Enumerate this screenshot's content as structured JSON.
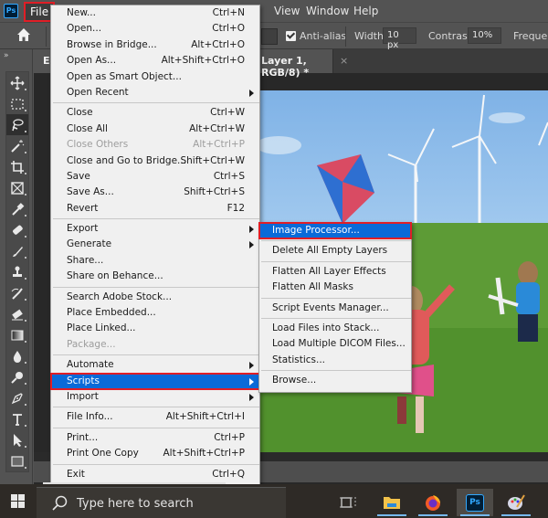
{
  "app": {
    "name": "Photoshop",
    "logo_text": "Ps"
  },
  "menubar": {
    "items": [
      {
        "label": "File",
        "active": true
      },
      {
        "label": "View"
      },
      {
        "label": "Window"
      },
      {
        "label": "Help"
      }
    ]
  },
  "options_bar": {
    "anti_alias_label": "Anti-alias",
    "anti_alias_checked": true,
    "width_label": "Width:",
    "width_value": "10 px",
    "contrast_label": "Contrast:",
    "contrast_value": "10%",
    "frequency_label": "Frequenc"
  },
  "document_tab": {
    "title_start": "E(",
    "title_end": "Layer 1, RGB/8) *",
    "close_glyph": "×"
  },
  "toolbar": {
    "collapse_glyph": "»",
    "tools": [
      "move-tool",
      "marquee-tool",
      "magnetic-lasso-tool",
      "magic-wand-tool",
      "crop-tool",
      "frame-tool",
      "eyedropper-tool",
      "healing-brush-tool",
      "brush-tool",
      "clone-stamp-tool",
      "history-brush-tool",
      "eraser-tool",
      "gradient-tool",
      "blur-tool",
      "dodge-tool",
      "pen-tool",
      "type-tool",
      "path-selection-tool",
      "rectangle-tool"
    ],
    "active_tool": "magnetic-lasso-tool"
  },
  "file_menu": {
    "groups": [
      [
        {
          "label": "New...",
          "shortcut": "Ctrl+N"
        },
        {
          "label": "Open...",
          "shortcut": "Ctrl+O"
        },
        {
          "label": "Browse in Bridge...",
          "shortcut": "Alt+Ctrl+O"
        },
        {
          "label": "Open As...",
          "shortcut": "Alt+Shift+Ctrl+O"
        },
        {
          "label": "Open as Smart Object...",
          "shortcut": ""
        },
        {
          "label": "Open Recent",
          "shortcut": "",
          "submenu": true
        }
      ],
      [
        {
          "label": "Close",
          "shortcut": "Ctrl+W"
        },
        {
          "label": "Close All",
          "shortcut": "Alt+Ctrl+W"
        },
        {
          "label": "Close Others",
          "shortcut": "Alt+Ctrl+P",
          "disabled": true
        },
        {
          "label": "Close and Go to Bridge...",
          "shortcut": "Shift+Ctrl+W"
        },
        {
          "label": "Save",
          "shortcut": "Ctrl+S"
        },
        {
          "label": "Save As...",
          "shortcut": "Shift+Ctrl+S"
        },
        {
          "label": "Revert",
          "shortcut": "F12"
        }
      ],
      [
        {
          "label": "Export",
          "shortcut": "",
          "submenu": true
        },
        {
          "label": "Generate",
          "shortcut": "",
          "submenu": true
        },
        {
          "label": "Share...",
          "shortcut": ""
        },
        {
          "label": "Share on Behance...",
          "shortcut": ""
        }
      ],
      [
        {
          "label": "Search Adobe Stock...",
          "shortcut": ""
        },
        {
          "label": "Place Embedded...",
          "shortcut": ""
        },
        {
          "label": "Place Linked...",
          "shortcut": ""
        },
        {
          "label": "Package...",
          "shortcut": "",
          "disabled": true
        }
      ],
      [
        {
          "label": "Automate",
          "shortcut": "",
          "submenu": true
        },
        {
          "label": "Scripts",
          "shortcut": "",
          "submenu": true,
          "highlighted": true
        },
        {
          "label": "Import",
          "shortcut": "",
          "submenu": true
        }
      ],
      [
        {
          "label": "File Info...",
          "shortcut": "Alt+Shift+Ctrl+I"
        }
      ],
      [
        {
          "label": "Print...",
          "shortcut": "Ctrl+P"
        },
        {
          "label": "Print One Copy",
          "shortcut": "Alt+Shift+Ctrl+P"
        }
      ],
      [
        {
          "label": "Exit",
          "shortcut": "Ctrl+Q"
        }
      ]
    ]
  },
  "scripts_menu": {
    "groups": [
      [
        {
          "label": "Image Processor...",
          "highlighted": true
        }
      ],
      [
        {
          "label": "Delete All Empty Layers"
        }
      ],
      [
        {
          "label": "Flatten All Layer Effects"
        },
        {
          "label": "Flatten All Masks"
        }
      ],
      [
        {
          "label": "Script Events Manager..."
        }
      ],
      [
        {
          "label": "Load Files into Stack..."
        },
        {
          "label": "Load Multiple DICOM Files..."
        },
        {
          "label": "Statistics..."
        }
      ],
      [
        {
          "label": "Browse..."
        }
      ]
    ]
  },
  "taskbar": {
    "search_placeholder": "Type here to search",
    "apps": [
      {
        "name": "task-view"
      },
      {
        "name": "file-explorer"
      },
      {
        "name": "firefox"
      },
      {
        "name": "photoshop",
        "label": "Ps",
        "active": true
      },
      {
        "name": "paint"
      }
    ]
  },
  "colors": {
    "highlight": "#0a6ad8",
    "callout_border": "#e01e26",
    "menu_bg": "#f0f0f0",
    "ui_gray": "#535353"
  }
}
